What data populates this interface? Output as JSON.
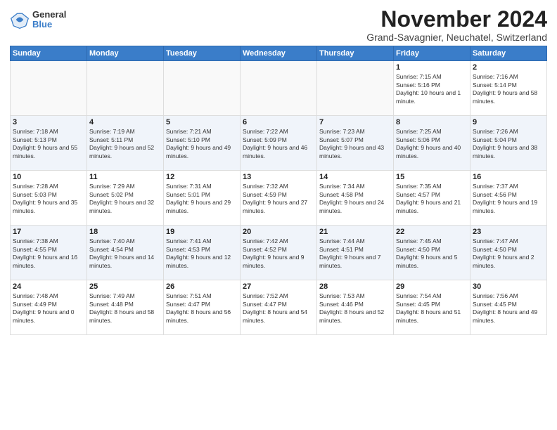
{
  "logo": {
    "general": "General",
    "blue": "Blue"
  },
  "title": "November 2024",
  "subtitle": "Grand-Savagnier, Neuchatel, Switzerland",
  "headers": [
    "Sunday",
    "Monday",
    "Tuesday",
    "Wednesday",
    "Thursday",
    "Friday",
    "Saturday"
  ],
  "weeks": [
    [
      {
        "day": "",
        "info": ""
      },
      {
        "day": "",
        "info": ""
      },
      {
        "day": "",
        "info": ""
      },
      {
        "day": "",
        "info": ""
      },
      {
        "day": "",
        "info": ""
      },
      {
        "day": "1",
        "info": "Sunrise: 7:15 AM\nSunset: 5:16 PM\nDaylight: 10 hours and 1 minute."
      },
      {
        "day": "2",
        "info": "Sunrise: 7:16 AM\nSunset: 5:14 PM\nDaylight: 9 hours and 58 minutes."
      }
    ],
    [
      {
        "day": "3",
        "info": "Sunrise: 7:18 AM\nSunset: 5:13 PM\nDaylight: 9 hours and 55 minutes."
      },
      {
        "day": "4",
        "info": "Sunrise: 7:19 AM\nSunset: 5:11 PM\nDaylight: 9 hours and 52 minutes."
      },
      {
        "day": "5",
        "info": "Sunrise: 7:21 AM\nSunset: 5:10 PM\nDaylight: 9 hours and 49 minutes."
      },
      {
        "day": "6",
        "info": "Sunrise: 7:22 AM\nSunset: 5:09 PM\nDaylight: 9 hours and 46 minutes."
      },
      {
        "day": "7",
        "info": "Sunrise: 7:23 AM\nSunset: 5:07 PM\nDaylight: 9 hours and 43 minutes."
      },
      {
        "day": "8",
        "info": "Sunrise: 7:25 AM\nSunset: 5:06 PM\nDaylight: 9 hours and 40 minutes."
      },
      {
        "day": "9",
        "info": "Sunrise: 7:26 AM\nSunset: 5:04 PM\nDaylight: 9 hours and 38 minutes."
      }
    ],
    [
      {
        "day": "10",
        "info": "Sunrise: 7:28 AM\nSunset: 5:03 PM\nDaylight: 9 hours and 35 minutes."
      },
      {
        "day": "11",
        "info": "Sunrise: 7:29 AM\nSunset: 5:02 PM\nDaylight: 9 hours and 32 minutes."
      },
      {
        "day": "12",
        "info": "Sunrise: 7:31 AM\nSunset: 5:01 PM\nDaylight: 9 hours and 29 minutes."
      },
      {
        "day": "13",
        "info": "Sunrise: 7:32 AM\nSunset: 4:59 PM\nDaylight: 9 hours and 27 minutes."
      },
      {
        "day": "14",
        "info": "Sunrise: 7:34 AM\nSunset: 4:58 PM\nDaylight: 9 hours and 24 minutes."
      },
      {
        "day": "15",
        "info": "Sunrise: 7:35 AM\nSunset: 4:57 PM\nDaylight: 9 hours and 21 minutes."
      },
      {
        "day": "16",
        "info": "Sunrise: 7:37 AM\nSunset: 4:56 PM\nDaylight: 9 hours and 19 minutes."
      }
    ],
    [
      {
        "day": "17",
        "info": "Sunrise: 7:38 AM\nSunset: 4:55 PM\nDaylight: 9 hours and 16 minutes."
      },
      {
        "day": "18",
        "info": "Sunrise: 7:40 AM\nSunset: 4:54 PM\nDaylight: 9 hours and 14 minutes."
      },
      {
        "day": "19",
        "info": "Sunrise: 7:41 AM\nSunset: 4:53 PM\nDaylight: 9 hours and 12 minutes."
      },
      {
        "day": "20",
        "info": "Sunrise: 7:42 AM\nSunset: 4:52 PM\nDaylight: 9 hours and 9 minutes."
      },
      {
        "day": "21",
        "info": "Sunrise: 7:44 AM\nSunset: 4:51 PM\nDaylight: 9 hours and 7 minutes."
      },
      {
        "day": "22",
        "info": "Sunrise: 7:45 AM\nSunset: 4:50 PM\nDaylight: 9 hours and 5 minutes."
      },
      {
        "day": "23",
        "info": "Sunrise: 7:47 AM\nSunset: 4:50 PM\nDaylight: 9 hours and 2 minutes."
      }
    ],
    [
      {
        "day": "24",
        "info": "Sunrise: 7:48 AM\nSunset: 4:49 PM\nDaylight: 9 hours and 0 minutes."
      },
      {
        "day": "25",
        "info": "Sunrise: 7:49 AM\nSunset: 4:48 PM\nDaylight: 8 hours and 58 minutes."
      },
      {
        "day": "26",
        "info": "Sunrise: 7:51 AM\nSunset: 4:47 PM\nDaylight: 8 hours and 56 minutes."
      },
      {
        "day": "27",
        "info": "Sunrise: 7:52 AM\nSunset: 4:47 PM\nDaylight: 8 hours and 54 minutes."
      },
      {
        "day": "28",
        "info": "Sunrise: 7:53 AM\nSunset: 4:46 PM\nDaylight: 8 hours and 52 minutes."
      },
      {
        "day": "29",
        "info": "Sunrise: 7:54 AM\nSunset: 4:45 PM\nDaylight: 8 hours and 51 minutes."
      },
      {
        "day": "30",
        "info": "Sunrise: 7:56 AM\nSunset: 4:45 PM\nDaylight: 8 hours and 49 minutes."
      }
    ]
  ]
}
